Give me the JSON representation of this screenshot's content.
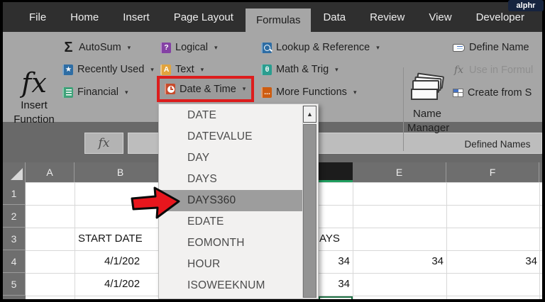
{
  "badge": {
    "label": "alphr"
  },
  "tabs": {
    "items": [
      "File",
      "Home",
      "Insert",
      "Page Layout",
      "Formulas",
      "Data",
      "Review",
      "View",
      "Developer"
    ],
    "active": "Formulas"
  },
  "ribbon": {
    "insert_function": {
      "line1": "Insert",
      "line2": "Function"
    },
    "function_library": [
      {
        "label": "AutoSum"
      },
      {
        "label": "Recently Used"
      },
      {
        "label": "Financial"
      },
      {
        "label": "Logical"
      },
      {
        "label": "Text"
      },
      {
        "label": "Date & Time"
      },
      {
        "label": "Lookup & Reference"
      },
      {
        "label": "Math & Trig"
      },
      {
        "label": "More Functions"
      }
    ],
    "defined_names": {
      "name_manager_line1": "Name",
      "name_manager_line2": "Manager",
      "define_name": "Define Name",
      "use_in_formula": "Use in Formul",
      "create_from": "Create from S",
      "group_label": "Defined Names"
    }
  },
  "formula_bar": {
    "fx": "fx"
  },
  "icons": {
    "fx_big": "fx",
    "sigma": "Σ",
    "star": "★",
    "question": "?",
    "letter_a": "A",
    "theta": "θ",
    "dots": "...",
    "caret": "▾",
    "up_arrow": "▲"
  },
  "dropdown": {
    "items": [
      "DATE",
      "DATEVALUE",
      "DAY",
      "DAYS",
      "DAYS360",
      "EDATE",
      "EOMONTH",
      "HOUR",
      "ISOWEEKNUM"
    ],
    "highlighted": "DAYS360"
  },
  "sheet": {
    "column_headers": [
      "A",
      "B",
      "E",
      "F"
    ],
    "row_headers": [
      "1",
      "2",
      "3",
      "4",
      "5"
    ],
    "cells": {
      "b3": "START DATE",
      "d3": "AYS",
      "b4": "4/1/202",
      "d4": "34",
      "e4": "34",
      "f4": "34",
      "b5": "4/1/202",
      "d5": "34"
    }
  },
  "colors": {
    "accent_red": "#dd1d1d",
    "excel_green": "#1f9e5f",
    "badge_navy": "#16243f"
  }
}
